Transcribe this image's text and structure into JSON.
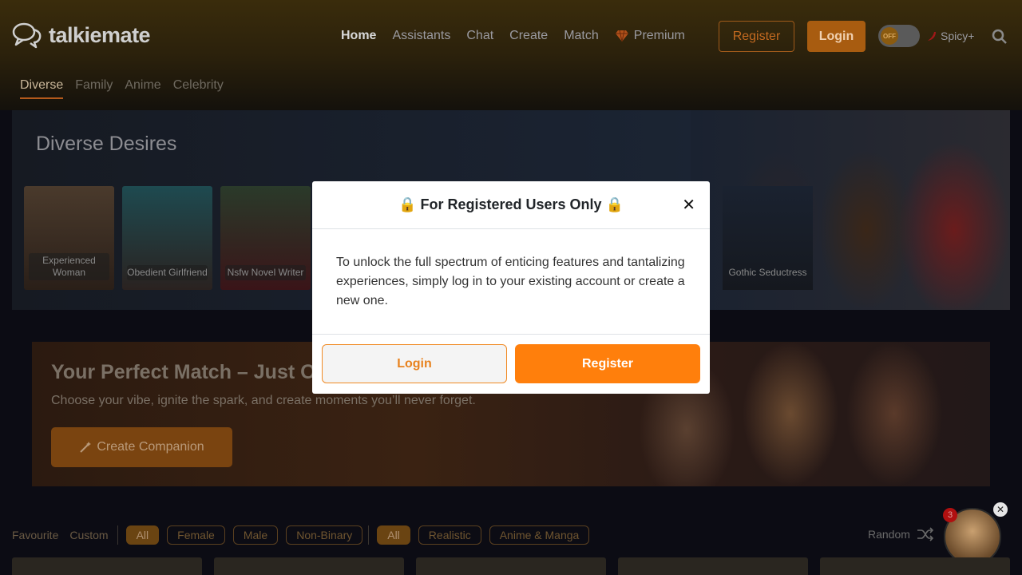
{
  "header": {
    "brand": "talkiemate",
    "nav": [
      {
        "label": "Home"
      },
      {
        "label": "Assistants"
      },
      {
        "label": "Chat"
      },
      {
        "label": "Create"
      },
      {
        "label": "Match"
      },
      {
        "label": "Premium"
      }
    ],
    "register_label": "Register",
    "login_label": "Login",
    "toggle_label": "OFF",
    "spicy_label": "Spicy+"
  },
  "category_tabs": [
    "Diverse",
    "Family",
    "Anime",
    "Celebrity"
  ],
  "banner": {
    "title": "Diverse Desires",
    "cards": [
      {
        "label": "Experienced Woman"
      },
      {
        "label": "Obedient Girlfriend"
      },
      {
        "label": "Nsfw Novel Writer"
      }
    ],
    "extra_card": {
      "label": "Gothic Seductress"
    }
  },
  "match": {
    "title": "Your Perfect Match – Just On",
    "subtitle": "Choose your vibe, ignite the spark, and create moments you’ll never forget.",
    "button_label": "Create Companion"
  },
  "filters": {
    "links": [
      "Favourite",
      "Custom"
    ],
    "gender": [
      "All",
      "Female",
      "Male",
      "Non-Binary"
    ],
    "style": [
      "All",
      "Realistic",
      "Anime & Manga"
    ],
    "random_label": "Random",
    "badge_count": "3"
  },
  "modal": {
    "title": "🔒 For Registered Users Only 🔒",
    "body": "To unlock the full spectrum of enticing features and tantalizing experiences, simply log in to your existing account or create a new one.",
    "login_label": "Login",
    "register_label": "Register"
  },
  "colors": {
    "accent": "#ff7f0c",
    "header_bg": "#3a2c0c"
  }
}
